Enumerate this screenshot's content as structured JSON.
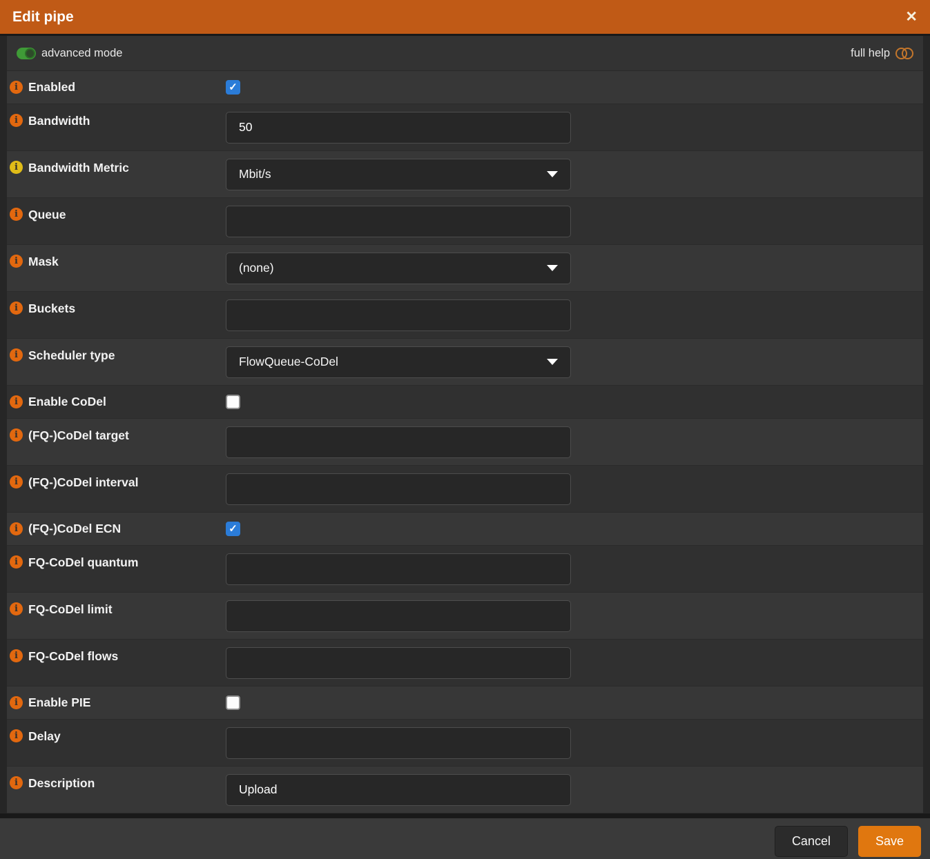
{
  "header": {
    "title": "Edit pipe",
    "close_icon": "✕"
  },
  "help_bar": {
    "advanced_mode_label": "advanced mode",
    "advanced_mode_on": true,
    "full_help_label": "full help",
    "full_help_on": false
  },
  "rows": [
    {
      "label": "Enabled",
      "type": "checkbox",
      "checked": true,
      "info": "orange"
    },
    {
      "label": "Bandwidth",
      "type": "text",
      "value": "50",
      "info": "orange"
    },
    {
      "label": "Bandwidth Metric",
      "type": "select",
      "value": "Mbit/s",
      "info": "yellow"
    },
    {
      "label": "Queue",
      "type": "text",
      "value": "",
      "info": "orange"
    },
    {
      "label": "Mask",
      "type": "select",
      "value": "(none)",
      "info": "orange"
    },
    {
      "label": "Buckets",
      "type": "text",
      "value": "",
      "info": "orange"
    },
    {
      "label": "Scheduler type",
      "type": "select",
      "value": "FlowQueue-CoDel",
      "info": "orange"
    },
    {
      "label": "Enable CoDel",
      "type": "checkbox",
      "checked": false,
      "info": "orange"
    },
    {
      "label": "(FQ-)CoDel target",
      "type": "text",
      "value": "",
      "info": "orange"
    },
    {
      "label": "(FQ-)CoDel interval",
      "type": "text",
      "value": "",
      "info": "orange"
    },
    {
      "label": "(FQ-)CoDel ECN",
      "type": "checkbox",
      "checked": true,
      "info": "orange"
    },
    {
      "label": "FQ-CoDel quantum",
      "type": "text",
      "value": "",
      "info": "orange"
    },
    {
      "label": "FQ-CoDel limit",
      "type": "text",
      "value": "",
      "info": "orange"
    },
    {
      "label": "FQ-CoDel flows",
      "type": "text",
      "value": "",
      "info": "orange"
    },
    {
      "label": "Enable PIE",
      "type": "checkbox",
      "checked": false,
      "info": "orange"
    },
    {
      "label": "Delay",
      "type": "text",
      "value": "",
      "info": "orange"
    },
    {
      "label": "Description",
      "type": "text",
      "value": "Upload",
      "info": "orange"
    }
  ],
  "icons": {
    "info_icon_glyph": "i",
    "checkbox_check_glyph": "✓"
  },
  "colors": {
    "header_orange": "#c05a16",
    "save_orange": "#e0770f",
    "checkbox_blue": "#2b7cd8",
    "toggle_green": "#3f9b37",
    "info_orange": "#e2680f",
    "info_yellow": "#e0bc18"
  },
  "footer": {
    "cancel_label": "Cancel",
    "save_label": "Save"
  }
}
